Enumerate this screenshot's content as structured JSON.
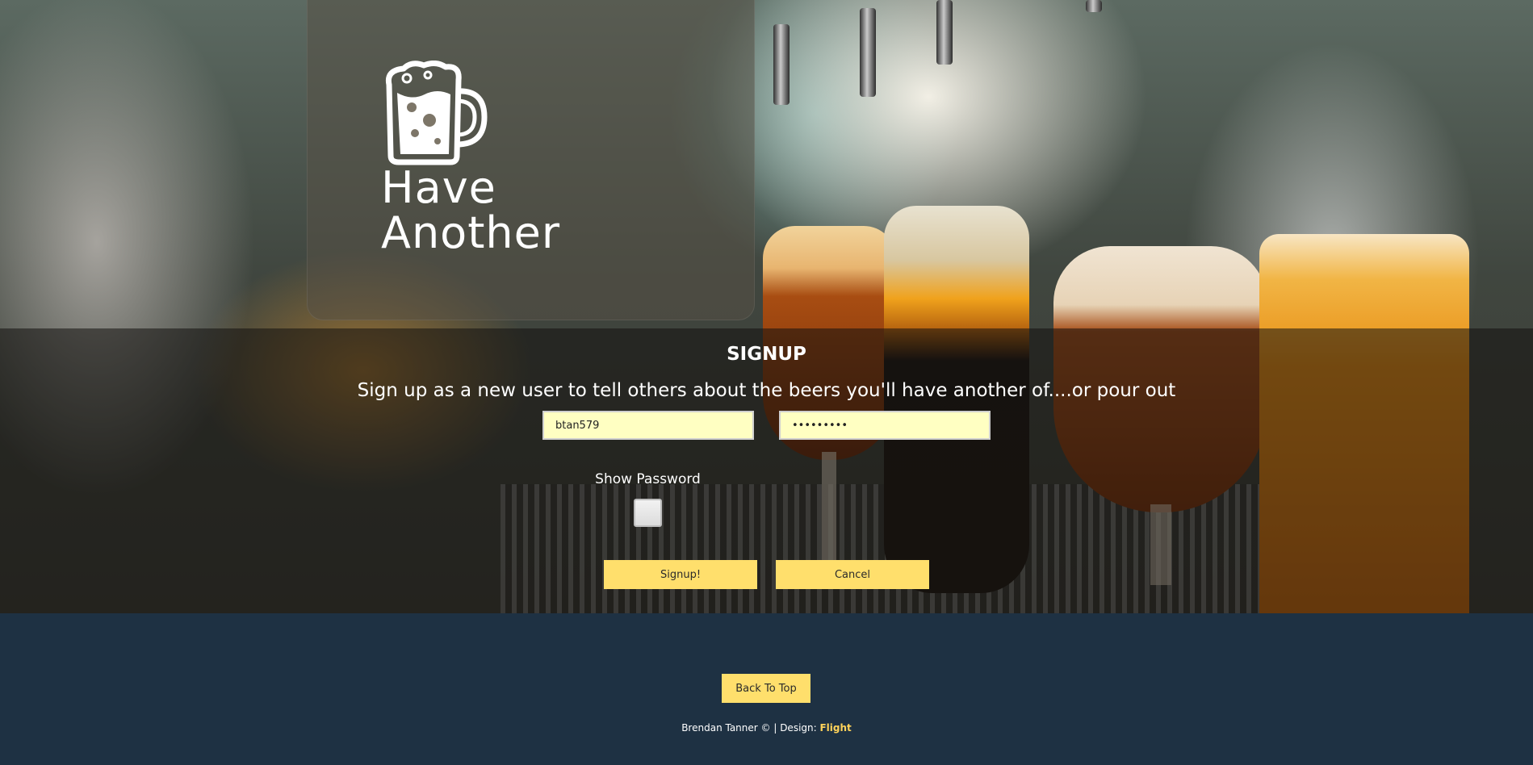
{
  "logo": {
    "line1": "Have",
    "line2": "Another",
    "icon": "beer-mug-icon"
  },
  "signup": {
    "title": "SIGNUP",
    "subtitle": "Sign up as a new user to tell others about the beers you'll have another of....or pour out",
    "username_value": "btan579",
    "password_value": "•••••••••",
    "show_password_label": "Show Password",
    "show_password_checked": false,
    "signup_button": "Signup!",
    "cancel_button": "Cancel"
  },
  "footer": {
    "back_to_top": "Back To Top",
    "credit_text": "Brendan Tanner © | Design: ",
    "credit_link": "Flight"
  },
  "colors": {
    "accent_yellow": "#ffdf6c",
    "footer_bg": "#1e3143",
    "input_bg": "#ffffc2",
    "link_yellow": "#ffd35a"
  }
}
